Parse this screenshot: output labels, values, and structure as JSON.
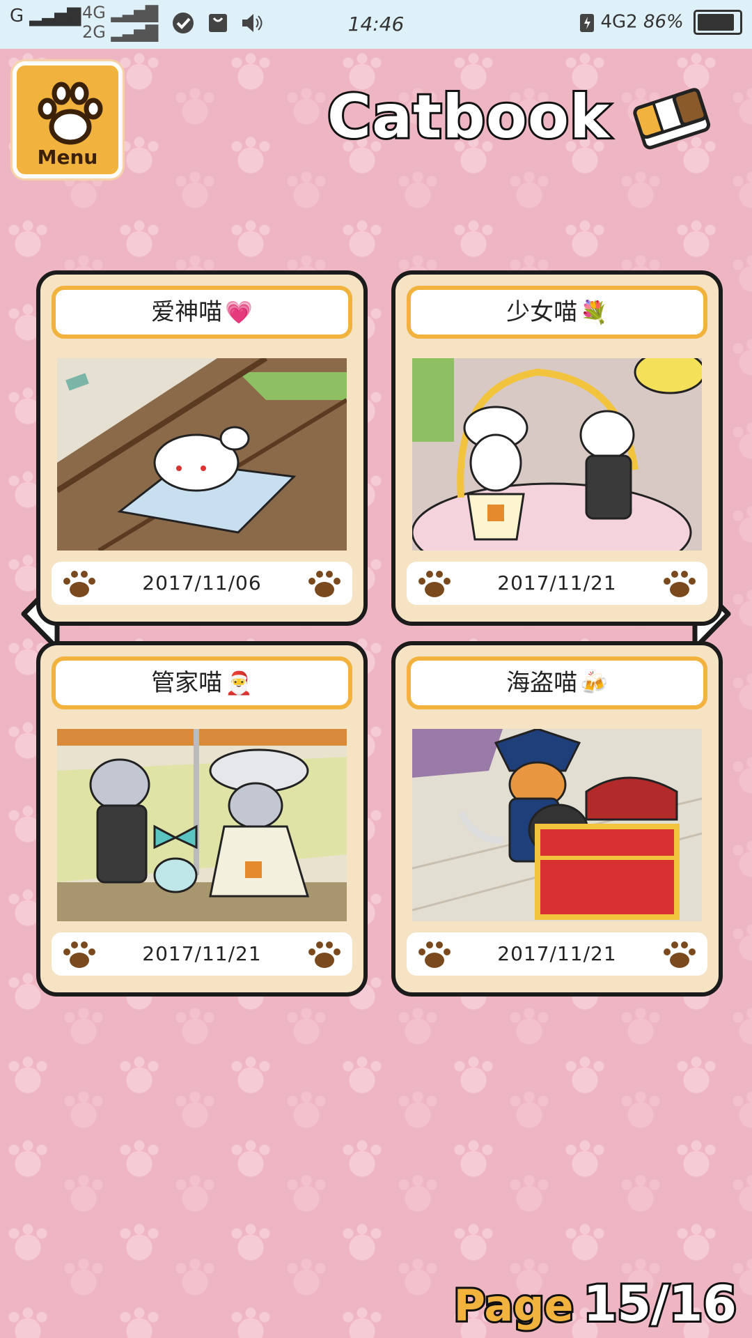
{
  "status_bar": {
    "carrier": "G",
    "net_top": "4G",
    "net_bottom": "2G",
    "time": "14:46",
    "right_net": "4G2",
    "battery": "86%"
  },
  "header": {
    "menu_label": "Menu",
    "title": "Catbook"
  },
  "cards": [
    {
      "name": "爱神喵",
      "emoji": "💗",
      "date": "2017/11/06"
    },
    {
      "name": "少女喵",
      "emoji": "💐",
      "date": "2017/11/21"
    },
    {
      "name": "管家喵",
      "emoji": "🎅",
      "date": "2017/11/21"
    },
    {
      "name": "海盗喵",
      "emoji": "🍻",
      "date": "2017/11/21"
    }
  ],
  "pagination": {
    "label": "Page",
    "value": "15/16"
  },
  "colors": {
    "background": "#eeb6c3",
    "card": "#f6e3c3",
    "accent": "#f2b23e"
  }
}
